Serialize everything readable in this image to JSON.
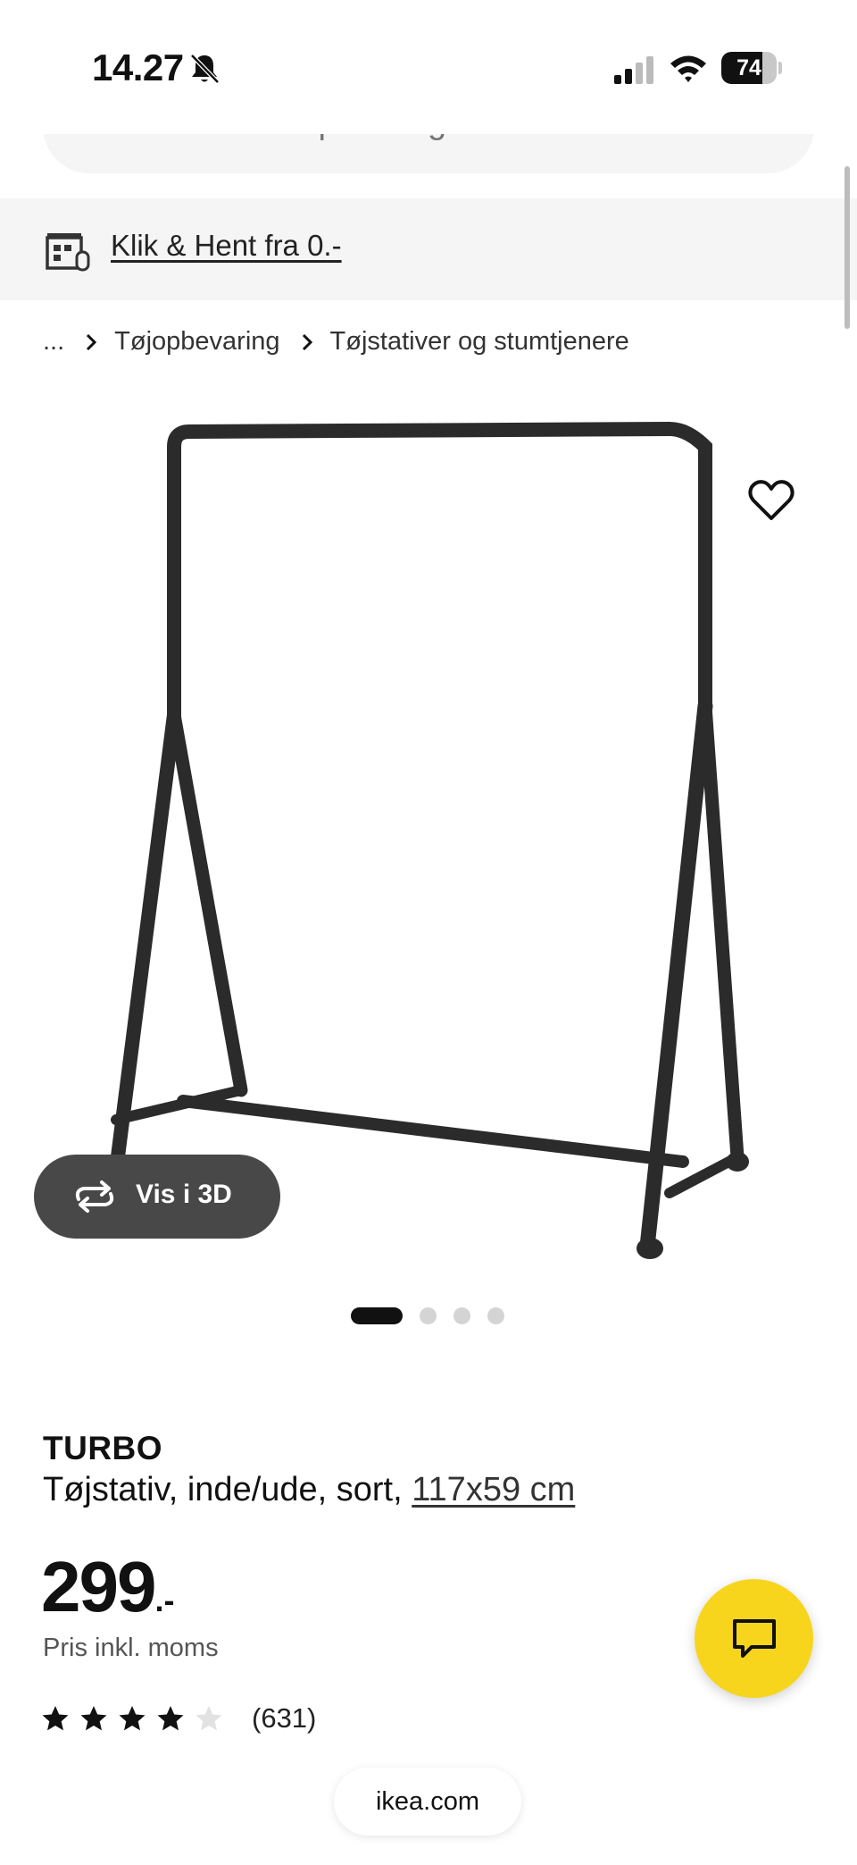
{
  "status_bar": {
    "time": "14.27",
    "battery_level": "74",
    "battery_fraction": 0.74,
    "icons": [
      "bell-slash-icon",
      "signal-icon",
      "wifi-icon",
      "battery-icon"
    ]
  },
  "search": {
    "placeholder": "Hvad er du på udkig efter?",
    "icons": [
      "search-icon",
      "camera-icon"
    ]
  },
  "click_collect": {
    "label": "Klik & Hent fra 0.-",
    "icon": "store-icon"
  },
  "breadcrumb": {
    "items": [
      "...",
      "Tøjopbevaring",
      "Tøjstativer og stumtjenere"
    ]
  },
  "gallery": {
    "view_3d_label": "Vis i 3D",
    "dot_count": 4,
    "active_index": 0,
    "icons": [
      "heart-icon",
      "rotate-icon"
    ]
  },
  "product": {
    "name": "TURBO",
    "description": "Tøjstativ, inde/ude, sort, ",
    "size": "117x59 cm",
    "price": "299",
    "price_suffix": ".-",
    "price_note": "Pris inkl. moms",
    "rating": 4,
    "rating_max": 5,
    "review_count": "(631)"
  },
  "chat": {
    "icon": "chat-icon",
    "color": "#f7d51d"
  },
  "browser": {
    "url": "ikea.com"
  }
}
